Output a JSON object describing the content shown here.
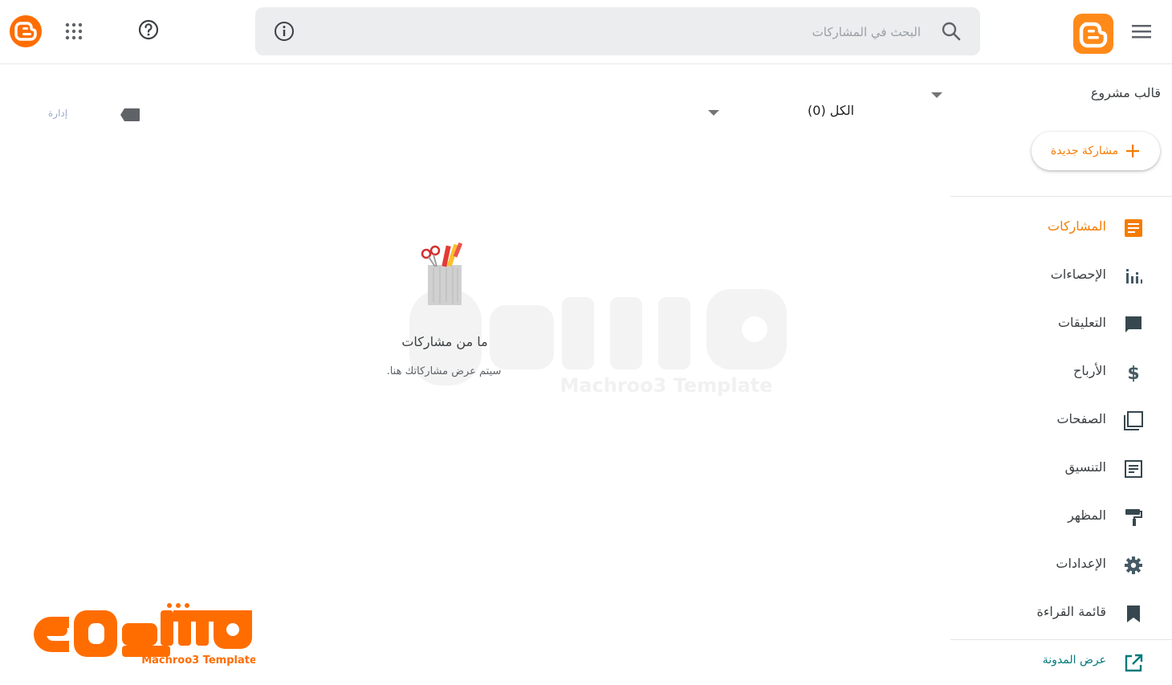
{
  "header": {
    "search_placeholder": "البحث في المشاركات"
  },
  "sidebar": {
    "blog_title": "قالب مشروع",
    "new_post_label": "مشاركة جديدة",
    "items": [
      {
        "label": "المشاركات",
        "icon": "posts-icon",
        "active": true
      },
      {
        "label": "الإحصاءات",
        "icon": "stats-icon"
      },
      {
        "label": "التعليقات",
        "icon": "comment-icon"
      },
      {
        "label": "الأرباح",
        "icon": "dollar-icon"
      },
      {
        "label": "الصفحات",
        "icon": "pages-icon"
      },
      {
        "label": "التنسيق",
        "icon": "layout-icon"
      },
      {
        "label": "المظهر",
        "icon": "paint-roller-icon"
      },
      {
        "label": "الإعدادات",
        "icon": "gear-icon"
      },
      {
        "label": "قائمة القراءة",
        "icon": "bookmark-icon"
      }
    ],
    "view_blog_label": "عرض المدونة"
  },
  "toolbar": {
    "filter_label": "الكل (0)",
    "manage_label": "إدارة"
  },
  "empty_state": {
    "title": "ما من مشاركات",
    "subtitle": "سيتم عرض مشاركاتك هنا."
  },
  "watermark": {
    "text": "Machroo3 Template"
  },
  "colors": {
    "accent": "#f57c00",
    "blogger_orange": "#ff8a1a",
    "search_bg": "#ebedee",
    "icon_gray": "#455a64",
    "view_blog": "#00797a"
  }
}
